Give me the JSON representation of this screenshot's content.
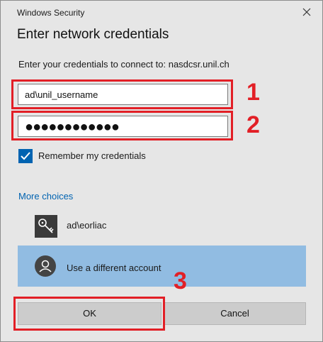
{
  "window": {
    "title": "Windows Security"
  },
  "dialog": {
    "heading": "Enter network credentials",
    "prompt": "Enter your credentials to connect to: nasdcsr.unil.ch"
  },
  "fields": {
    "username_value": "ad\\unil_username",
    "password_mask": "●●●●●●●●●●●●"
  },
  "remember": {
    "label": "Remember my credentials",
    "checked": true
  },
  "more_choices": {
    "label": "More choices"
  },
  "accounts": [
    {
      "label": "ad\\eorliac",
      "icon": "key-icon"
    },
    {
      "label": "Use a different account",
      "icon": "person-icon"
    }
  ],
  "buttons": {
    "ok": "OK",
    "cancel": "Cancel"
  },
  "annotations": {
    "one": "1",
    "two": "2",
    "three": "3"
  },
  "colors": {
    "accent": "#0063b1",
    "highlight_red": "#e21f26",
    "selected_row": "#91bce2"
  }
}
